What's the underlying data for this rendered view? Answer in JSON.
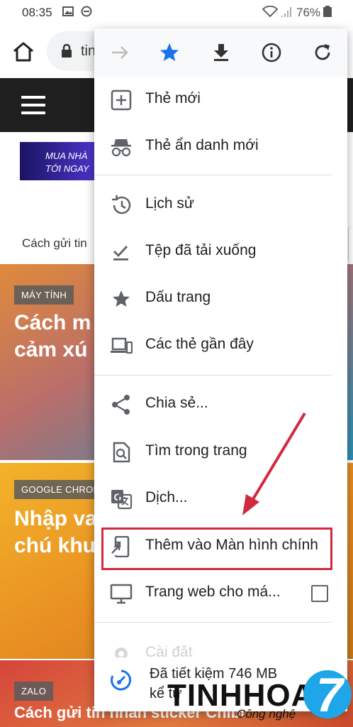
{
  "status_bar": {
    "time": "08:35",
    "battery": "76%"
  },
  "toolbar": {
    "url": "tin"
  },
  "page": {
    "banner": {
      "line1": "MUA NHÀ",
      "line2": "TỚI NGAY"
    },
    "breadcrumb": "Cách gửi tin",
    "cards": [
      {
        "tag": "MÁY TÍNH",
        "title_line1": "Cách m",
        "title_line2": "cảm xú"
      },
      {
        "tag": "GOOGLE CHROM",
        "title_line1": "Nhập va",
        "title_line2": "chú khu"
      },
      {
        "tag": "ZALO",
        "title_line1": "Cách gửi tin nhắn sticker Chibi"
      }
    ]
  },
  "menu": {
    "top_icons": [
      "forward-icon",
      "star-icon",
      "download-icon",
      "info-icon",
      "refresh-icon"
    ],
    "accent": "#1a73e8",
    "items": [
      {
        "label": "Thẻ mới",
        "icon": "new-tab-icon"
      },
      {
        "label": "Thẻ ẩn danh mới",
        "icon": "incognito-icon"
      },
      {
        "label": "Lịch sử",
        "icon": "history-icon"
      },
      {
        "label": "Tệp đã tải xuống",
        "icon": "downloads-icon"
      },
      {
        "label": "Dấu trang",
        "icon": "bookmark-star-icon"
      },
      {
        "label": "Các thẻ gần đây",
        "icon": "recent-tabs-icon"
      },
      {
        "label": "Chia sẻ...",
        "icon": "share-icon"
      },
      {
        "label": "Tìm trong trang",
        "icon": "find-in-page-icon"
      },
      {
        "label": "Dịch...",
        "icon": "translate-icon"
      },
      {
        "label": "Thêm vào Màn hình chính",
        "icon": "add-to-home-icon"
      },
      {
        "label": "Trang web cho má...",
        "icon": "desktop-icon",
        "checked": false
      },
      {
        "label": "Cài đặt",
        "icon": "settings-icon"
      }
    ],
    "savings": {
      "line1": "Đã tiết kiệm 746 MB",
      "line2": "kể từ"
    }
  },
  "annotation_color": "#d1293d",
  "logo": {
    "word": "TINHHOA",
    "sub": "Công nghệ",
    "badge": "7"
  }
}
